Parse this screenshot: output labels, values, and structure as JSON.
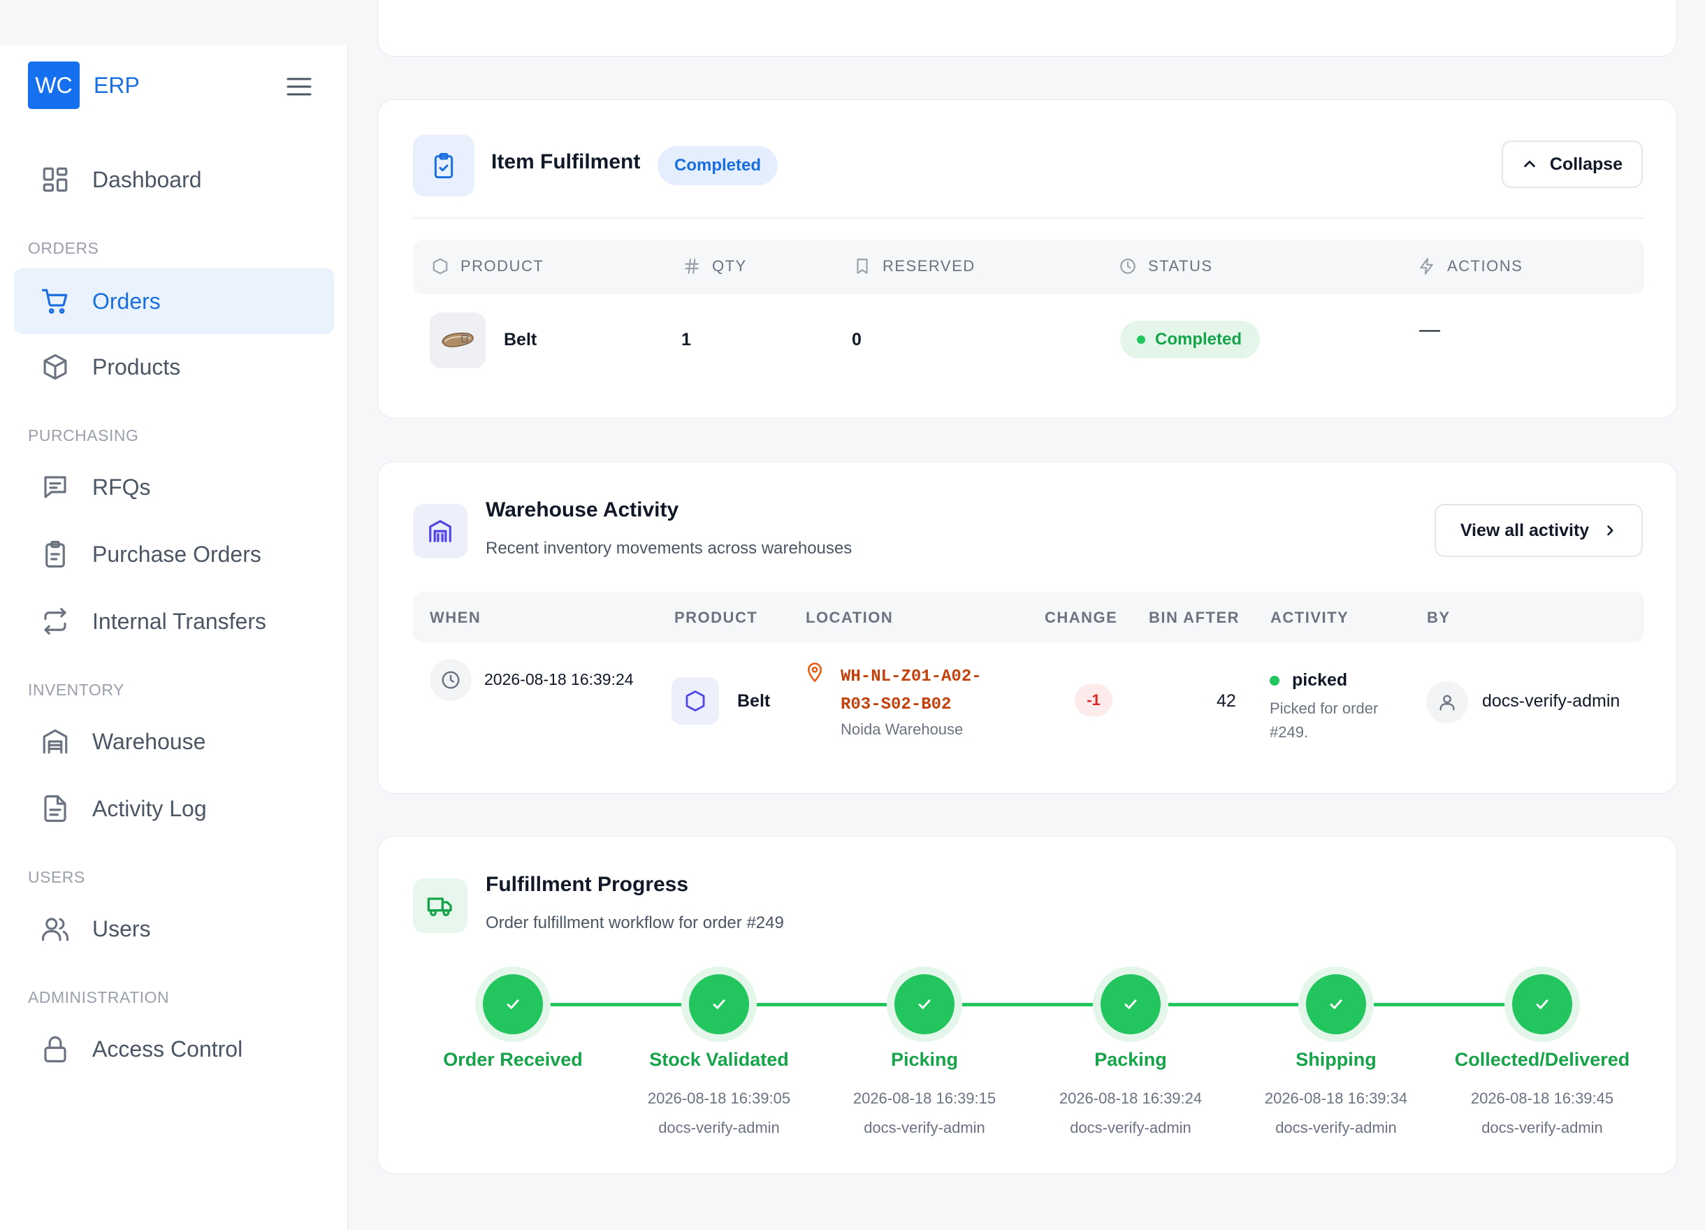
{
  "brand": {
    "logo": "WC",
    "name": "ERP"
  },
  "sidebar": {
    "menu_icon": "hamburger-icon",
    "items": [
      {
        "label": "Dashboard",
        "icon": "dashboard-icon"
      },
      {
        "section": "ORDERS"
      },
      {
        "label": "Orders",
        "icon": "cart-icon",
        "active": true
      },
      {
        "label": "Products",
        "icon": "box-icon"
      },
      {
        "section": "PURCHASING"
      },
      {
        "label": "RFQs",
        "icon": "chat-icon"
      },
      {
        "label": "Purchase Orders",
        "icon": "clipboard-icon"
      },
      {
        "label": "Internal Transfers",
        "icon": "transfer-icon"
      },
      {
        "section": "INVENTORY"
      },
      {
        "label": "Warehouse",
        "icon": "warehouse-icon"
      },
      {
        "label": "Activity Log",
        "icon": "file-icon"
      },
      {
        "section": "USERS"
      },
      {
        "label": "Users",
        "icon": "users-icon"
      },
      {
        "section": "ADMINISTRATION"
      },
      {
        "label": "Access Control",
        "icon": "lock-icon"
      }
    ]
  },
  "fulfilment": {
    "title": "Item Fulfilment",
    "status_badge": "Completed",
    "collapse_label": "Collapse",
    "columns": [
      "PRODUCT",
      "QTY",
      "RESERVED",
      "STATUS",
      "ACTIONS"
    ],
    "rows": [
      {
        "product": "Belt",
        "qty": "1",
        "reserved": "0",
        "status": "Completed",
        "actions": "—"
      }
    ]
  },
  "warehouse": {
    "title": "Warehouse Activity",
    "subtitle": "Recent inventory movements across warehouses",
    "view_all_label": "View all activity",
    "columns": [
      "WHEN",
      "PRODUCT",
      "LOCATION",
      "CHANGE",
      "BIN AFTER",
      "ACTIVITY",
      "BY"
    ],
    "rows": [
      {
        "when": "2026-08-18 16:39:24",
        "product": "Belt",
        "location_line1": "WH-NL-Z01-A02-",
        "location_line2": "R03-S02-B02",
        "warehouse": "Noida Warehouse",
        "change": "-1",
        "bin_after": "42",
        "activity": "picked",
        "activity_note_line1": "Picked for order",
        "activity_note_line2": "#249.",
        "by": "docs-verify-admin"
      }
    ]
  },
  "progress": {
    "title": "Fulfillment Progress",
    "subtitle": "Order fulfillment workflow for order #249",
    "steps": [
      {
        "label": "Order Received",
        "time": "",
        "user": ""
      },
      {
        "label": "Stock Validated",
        "time": "2026-08-18 16:39:05",
        "user": "docs-verify-admin"
      },
      {
        "label": "Picking",
        "time": "2026-08-18 16:39:15",
        "user": "docs-verify-admin"
      },
      {
        "label": "Packing",
        "time": "2026-08-18 16:39:24",
        "user": "docs-verify-admin"
      },
      {
        "label": "Shipping",
        "time": "2026-08-18 16:39:34",
        "user": "docs-verify-admin"
      },
      {
        "label": "Collected/Delivered",
        "time": "2026-08-18 16:39:45",
        "user": "docs-verify-admin"
      }
    ]
  },
  "colors": {
    "accent": "#1570ef",
    "success": "#22c55e",
    "success_text": "#16a34a",
    "danger": "#dc2626",
    "location": "#c2410c"
  }
}
